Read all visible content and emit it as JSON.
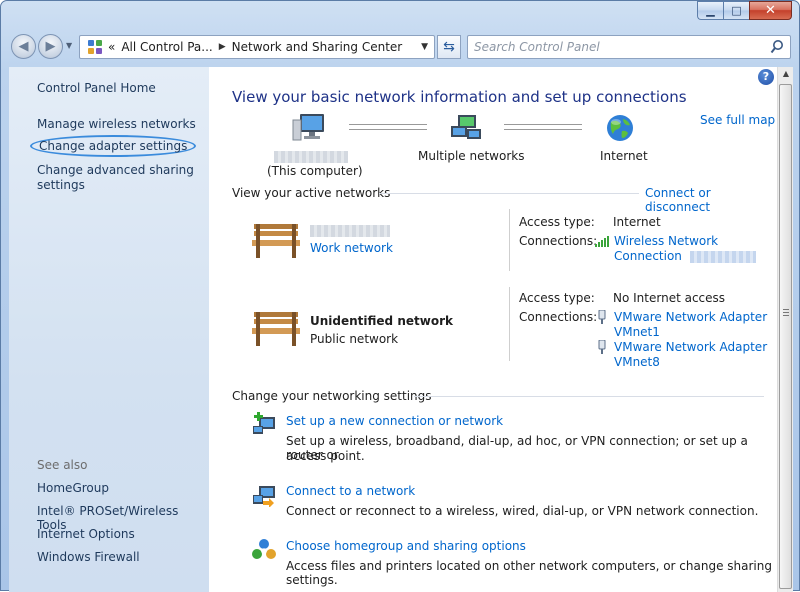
{
  "window": {
    "minimize_label": "▁",
    "maximize_label": "□",
    "close_label": "✕"
  },
  "nav": {
    "breadcrumbs_overflow": "«",
    "breadcrumb_1": "All Control Pa...",
    "breadcrumb_2": "Network and Sharing Center",
    "search_placeholder": "Search Control Panel"
  },
  "sidebar": {
    "home": "Control Panel Home",
    "items": [
      {
        "label": "Manage wireless networks"
      },
      {
        "label": "Change adapter settings"
      },
      {
        "label": "Change advanced sharing"
      },
      {
        "label": "settings"
      }
    ],
    "see_also_heading": "See also",
    "see_also": [
      {
        "label": "HomeGroup"
      },
      {
        "label": "Intel® PROSet/Wireless Tools"
      },
      {
        "label": "Internet Options"
      },
      {
        "label": "Windows Firewall"
      }
    ]
  },
  "main": {
    "title": "View your basic network information and set up connections",
    "see_full_map": "See full map",
    "map": {
      "computer_label": "(This computer)",
      "multiple_networks": "Multiple networks",
      "internet": "Internet"
    },
    "active_networks_heading": "View your active networks",
    "connect_or_disconnect": "Connect or disconnect",
    "network1": {
      "type_link": "Work network",
      "access_type_label": "Access type:",
      "access_type_value": "Internet",
      "connections_label": "Connections:",
      "connection_line1": "Wireless Network",
      "connection_line2": "Connection"
    },
    "network2": {
      "name": "Unidentified network",
      "type": "Public network",
      "access_type_label": "Access type:",
      "access_type_value": "No Internet access",
      "connections_label": "Connections:",
      "conn1_line1": "VMware Network Adapter",
      "conn1_line2": "VMnet1",
      "conn2_line1": "VMware Network Adapter",
      "conn2_line2": "VMnet8"
    },
    "change_settings_heading": "Change your networking settings",
    "tasks": [
      {
        "link": "Set up a new connection or network",
        "desc1": "Set up a wireless, broadband, dial-up, ad hoc, or VPN connection; or set up a router or",
        "desc2": "access point."
      },
      {
        "link": "Connect to a network",
        "desc1": "Connect or reconnect to a wireless, wired, dial-up, or VPN network connection.",
        "desc2": ""
      },
      {
        "link": "Choose homegroup and sharing options",
        "desc1": "Access files and printers located on other network computers, or change sharing settings.",
        "desc2": ""
      }
    ]
  },
  "colors": {
    "accent_link": "#0066cc",
    "title_blue": "#1e3287",
    "sidebar_link": "#1e395b",
    "highlight_ring": "#3a8bdc"
  }
}
